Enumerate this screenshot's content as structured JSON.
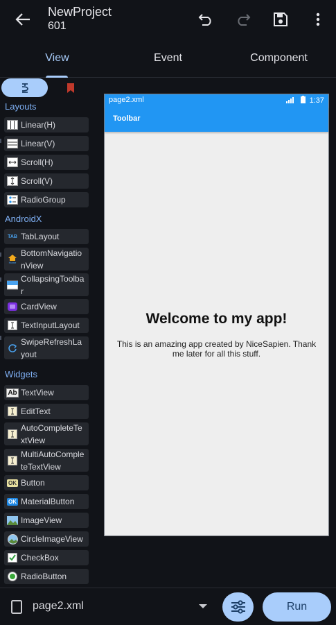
{
  "appbar": {
    "title": "NewProject",
    "subtitle": "601"
  },
  "tabs": [
    {
      "label": "View",
      "active": true
    },
    {
      "label": "Event",
      "active": false
    },
    {
      "label": "Component",
      "active": false
    }
  ],
  "palette": {
    "sections": [
      {
        "title": "Layouts"
      },
      {
        "title": "AndroidX"
      },
      {
        "title": "Widgets"
      }
    ],
    "layouts": [
      {
        "label": "Linear(H)",
        "icon": "linear-horizontal-icon"
      },
      {
        "label": "Linear(V)",
        "icon": "linear-vertical-icon"
      },
      {
        "label": "Scroll(H)",
        "icon": "scroll-horizontal-icon"
      },
      {
        "label": "Scroll(V)",
        "icon": "scroll-vertical-icon"
      },
      {
        "label": "RadioGroup",
        "icon": "radio-group-icon"
      }
    ],
    "androidx": [
      {
        "label": "TabLayout",
        "icon": "tab-layout-icon"
      },
      {
        "label": "BottomNavigationView",
        "icon": "bottom-navigation-icon"
      },
      {
        "label": "CollapsingToolbar",
        "icon": "collapsing-toolbar-icon"
      },
      {
        "label": "CardView",
        "icon": "card-view-icon"
      },
      {
        "label": "TextInputLayout",
        "icon": "text-input-layout-icon"
      },
      {
        "label": "SwipeRefreshLayout",
        "icon": "swipe-refresh-icon"
      }
    ],
    "widgets": [
      {
        "label": "TextView",
        "icon": "text-view-icon"
      },
      {
        "label": "EditText",
        "icon": "edit-text-icon"
      },
      {
        "label": "AutoCompleteTextView",
        "icon": "autocomplete-icon"
      },
      {
        "label": "MultiAutoCompleteTextView",
        "icon": "multi-autocomplete-icon"
      },
      {
        "label": "Button",
        "icon": "button-icon"
      },
      {
        "label": "MaterialButton",
        "icon": "material-button-icon"
      },
      {
        "label": "ImageView",
        "icon": "image-view-icon"
      },
      {
        "label": "CircleImageView",
        "icon": "circle-image-view-icon"
      },
      {
        "label": "CheckBox",
        "icon": "checkbox-icon"
      },
      {
        "label": "RadioButton",
        "icon": "radio-button-icon"
      }
    ]
  },
  "icon_texts": {
    "tab": "TAB",
    "home": "Home",
    "textview": "Ab",
    "ok": "OK"
  },
  "preview": {
    "file": "page2.xml",
    "time": "1:37",
    "toolbar_title": "Toolbar",
    "heading": "Welcome to my app!",
    "body": "This is an amazing app created by NiceSapien. Thank me later for all this stuff."
  },
  "bottom": {
    "file_name": "page2.xml",
    "run_label": "Run"
  },
  "colors": {
    "accent": "#a9cdfb",
    "toolbar": "#2196f3",
    "background": "#111318",
    "item_bg": "#25282e",
    "section": "#7fb0f4"
  }
}
